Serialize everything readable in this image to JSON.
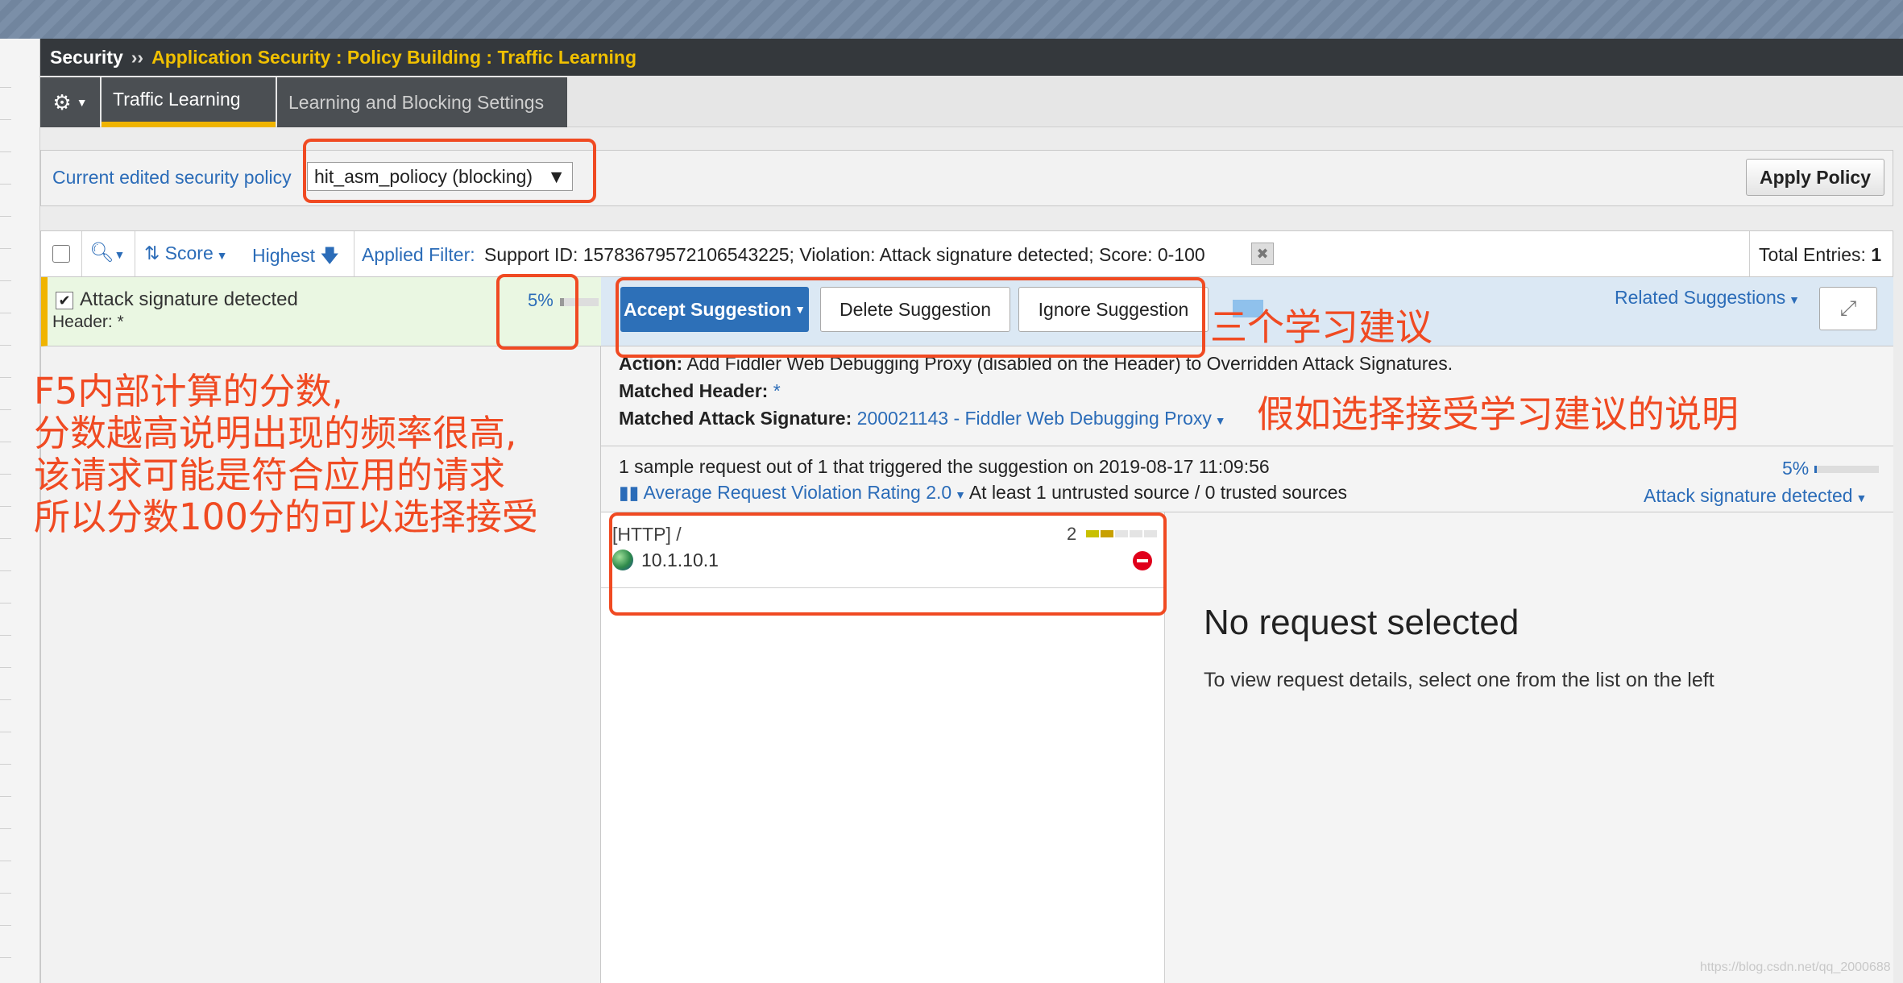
{
  "breadcrumb": {
    "root": "Security",
    "separator": "››",
    "path": "Application Security : Policy Building : Traffic Learning"
  },
  "tabs": [
    {
      "label": "Traffic Learning",
      "active": true
    },
    {
      "label": "Learning and Blocking Settings",
      "active": false
    }
  ],
  "policy": {
    "label": "Current edited security policy",
    "selected": "hit_asm_poliocy (blocking)",
    "apply_label": "Apply Policy"
  },
  "filter": {
    "sort_label": "Score",
    "order_label": "Highest",
    "applied_label": "Applied Filter:",
    "applied_text": "Support ID: 15783679572106543225; Violation: Attack signature detected; Score: 0-100",
    "total_label": "Total Entries:",
    "total_value": "1"
  },
  "suggestion_item": {
    "title": "Attack signature detected",
    "subtitle": "Header: *",
    "score": "5%",
    "score_value": 0.05
  },
  "actions": {
    "accept": "Accept Suggestion",
    "delete": "Delete Suggestion",
    "ignore": "Ignore Suggestion",
    "related": "Related Suggestions"
  },
  "details": {
    "action_label": "Action:",
    "action_text": "Add Fiddler Web Debugging Proxy (disabled on the Header) to Overridden Attack Signatures.",
    "header_label": "Matched Header:",
    "header_value": "*",
    "signature_label": "Matched Attack Signature:",
    "signature_value": "200021143 - Fiddler Web Debugging Proxy"
  },
  "sample": {
    "summary": "1 sample request out of 1 that triggered the suggestion on 2019-08-17 11:09:56",
    "rating_link": "Average Request Violation Rating 2.0",
    "sources": "At least 1 untrusted source / 0 trusted sources",
    "pct": "5%",
    "violation": "Attack signature detected"
  },
  "request": {
    "method_path": "[HTTP] /",
    "ip": "10.1.10.1",
    "rating": "2"
  },
  "empty_state": {
    "title": "No request selected",
    "subtitle": "To view request details, select one from the list on the left"
  },
  "annotations": {
    "left_lines": [
      "F5内部计算的分数,",
      "分数越高说明出现的频率很高,",
      "该请求可能是符合应用的请求",
      "所以分数100分的可以选择接受"
    ],
    "suggestions": "三个学习建议",
    "explanation": "假如选择接受学习建议的说明",
    "color": "#f04a22"
  },
  "watermark": "https://blog.csdn.net/qq_2000688"
}
